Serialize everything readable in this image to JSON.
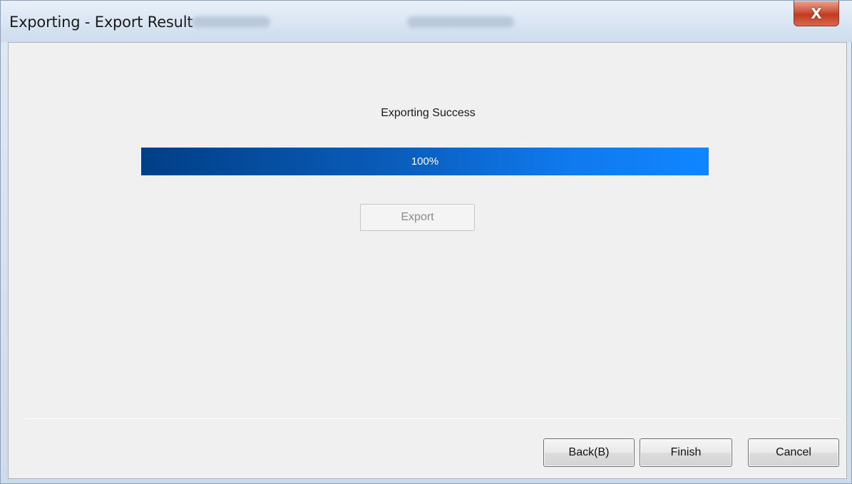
{
  "window": {
    "title": "Exporting - Export Result",
    "close_label": "X"
  },
  "main": {
    "status_text": "Exporting Success",
    "progress": {
      "value": 100,
      "label": "100%"
    },
    "export_label": "Export"
  },
  "footer": {
    "back_label": "Back(B)",
    "finish_label": "Finish",
    "cancel_label": "Cancel"
  },
  "colors": {
    "progress_start": "#003f86",
    "progress_end": "#0f86ff",
    "close_button": "#c23a20"
  }
}
